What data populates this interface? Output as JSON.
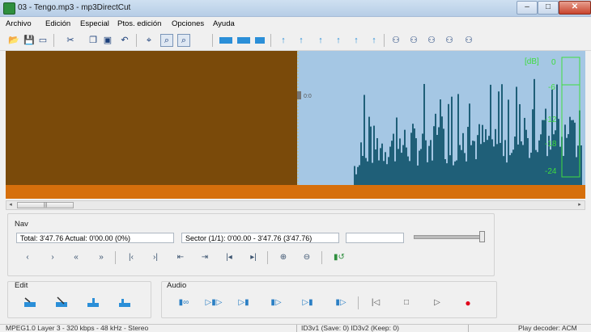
{
  "window": {
    "title": "03 - Tengo.mp3 - mp3DirectCut",
    "min_glyph": "–",
    "max_glyph": "□",
    "close_glyph": "✕"
  },
  "menu": [
    "Archivo",
    "Edición",
    "Especial",
    "Ptos. edición",
    "Opciones",
    "Ayuda"
  ],
  "waveform": {
    "selection_color": "#7a4a0a",
    "wave_color": "#1f5f78",
    "background": "#a5c7e4",
    "cursor_label": "0:0",
    "db_label": "[dB]",
    "db_ticks": [
      "0",
      "-6",
      "-12",
      "-18",
      "-24"
    ],
    "db_color": "#3fdc3f",
    "bottom_bar_color": "#d66f0c",
    "scroll_thumb_grip": "|||"
  },
  "nav": {
    "label": "Nav",
    "info": "Total:  3'47.76   Actual:  0'00.00   (0%)",
    "sector": "Sector (1/1): 0'00.00 - 3'47.76 (3'47.76)",
    "buttons": [
      "‹",
      "›",
      "«",
      "»",
      "|‹",
      "›|",
      "⇤",
      "⇥",
      "|◂",
      "▸|",
      "⊕",
      "⊖",
      "▮↺"
    ]
  },
  "edit": {
    "label": "Edit"
  },
  "audio": {
    "label": "Audio",
    "buttons": [
      "▮∞",
      "▷▮▷",
      "▷▮",
      "▮▷",
      "▷▮",
      "▮▷",
      "|◁",
      "□",
      "▷",
      "●"
    ]
  },
  "status": {
    "format": "MPEG1.0 Layer 3 - 320 kbps - 48 kHz - Stereo",
    "tags": "ID3v1 (Save: 0)    ID3v2 (Keep: 0)",
    "decoder": "Play decoder: ACM"
  },
  "toolbar": {
    "icons": [
      "open-folder-icon",
      "save-icon",
      "save-as-icon",
      "cut-icon",
      "copy-icon",
      "paste-icon",
      "undo-icon",
      "zoom-icon-1",
      "zoom-icon-2",
      "zoom-icon-3",
      "wave-view-icon-1",
      "wave-view-icon-2",
      "wave-view-icon-3",
      "marker-icon-1",
      "marker-icon-2",
      "marker-icon-3",
      "marker-icon-4",
      "marker-icon-5",
      "marker-icon-6",
      "person-icon-1",
      "person-icon-2",
      "person-icon-3",
      "person-icon-4",
      "person-icon-5"
    ],
    "glyphs": [
      "📂",
      "💾",
      "▭",
      "✂",
      "❐",
      "▣",
      "↶",
      "⌖",
      "⌕",
      "⌕",
      "▬",
      "▬",
      "⌂",
      "↑",
      "↑",
      "↑",
      "↑",
      "↑",
      "↑",
      "⚇",
      "⚇",
      "⚇",
      "⚇",
      "⚇"
    ]
  }
}
